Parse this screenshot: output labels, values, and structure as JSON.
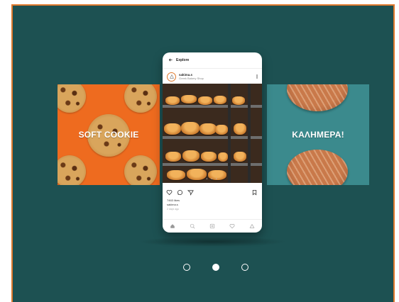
{
  "colors": {
    "background": "#1d5152",
    "frame_border": "#e07a2e",
    "left_card": "#ee6b1f",
    "right_card": "#3b8a8d",
    "dot_active": "#ffffff"
  },
  "left_card": {
    "text": "SOFT COOKIE"
  },
  "right_card": {
    "text": "ΚΑΛΗΜΕΡΑ!"
  },
  "phone": {
    "header_title": "Explore",
    "username": "sakima.s",
    "user_subtitle": "Greek Bakery Shop",
    "likes_text": "7463 likes",
    "caption_user": "sakima.s",
    "time_text": "2 days ago",
    "icons": {
      "back": "arrow-left-icon",
      "like": "heart-icon",
      "comment": "comment-icon",
      "share": "send-icon",
      "save": "bookmark-icon",
      "nav": [
        "home-icon",
        "search-icon",
        "add-icon",
        "heart-icon",
        "profile-icon"
      ]
    }
  },
  "carousel": {
    "dots": 3,
    "active_index": 1
  }
}
